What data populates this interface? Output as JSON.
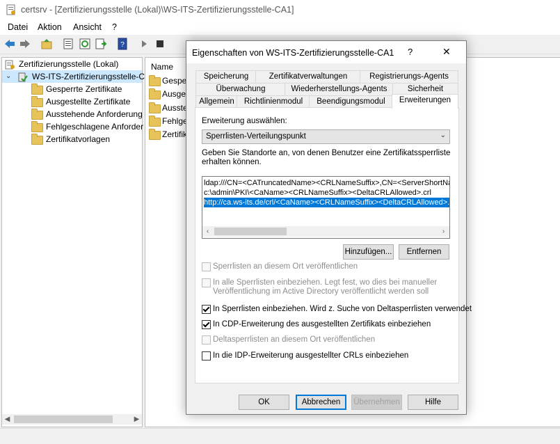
{
  "window": {
    "title": "certsrv - [Zertifizierungsstelle (Lokal)\\WS-ITS-Zertifizierungsstelle-CA1]"
  },
  "menu": [
    "Datei",
    "Aktion",
    "Ansicht",
    "?"
  ],
  "tree": {
    "root": "Zertifizierungsstelle (Lokal)",
    "ca": "WS-ITS-Zertifizierungsstelle-C",
    "folders": [
      "Gesperrte Zertifikate",
      "Ausgestellte Zertifikate",
      "Ausstehende Anforderung",
      "Fehlgeschlagene Anforder",
      "Zertifikatvorlagen"
    ]
  },
  "list": {
    "header": "Name",
    "items": [
      "Gesper",
      "Ausges",
      "Ausste",
      "Fehlge",
      "Zertifik"
    ]
  },
  "dialog": {
    "title": "Eigenschaften von WS-ITS-Zertifizierungsstelle-CA1",
    "help_label": "?",
    "close_label": "✕",
    "tabs_row1": [
      "Speicherung",
      "Zertifikatverwaltungen",
      "Registrierungs-Agents"
    ],
    "tabs_row2": [
      "Überwachung",
      "Wiederherstellungs-Agents",
      "Sicherheit"
    ],
    "tabs_row3": [
      "Allgemein",
      "Richtlinienmodul",
      "Beendigungsmodul",
      "Erweiterungen"
    ],
    "extension_label": "Erweiterung auswählen:",
    "extension_value": "Sperrlisten-Verteilungspunkt",
    "description": [
      "Geben Sie Standorte an, von denen Benutzer eine Zertifikatssperrliste",
      "erhalten können."
    ],
    "urls": [
      "ldap:///CN=<CATruncatedName><CRLNameSuffix>,CN=<ServerShortName>,CN=CDP,CN=Public Key Services",
      "c:\\admin\\PKI\\<CaName><CRLNameSuffix><DeltaCRLAllowed>.crl",
      "http://ca.ws-its.de/crl/<CaName><CRLNameSuffix><DeltaCRLAllowed>.crl"
    ],
    "add_label": "Hinzufügen...",
    "remove_label": "Entfernen",
    "options": [
      {
        "text": "Sperrlisten an diesem Ort veröffentlichen",
        "checked": false,
        "enabled": false
      },
      {
        "text": "In alle Sperrlisten einbeziehen. Legt fest, wo dies bei manueller",
        "text2": "Veröffentlichung im Active Directory veröffentlicht werden soll",
        "checked": false,
        "enabled": false
      },
      {
        "text": "In Sperrlisten einbeziehen. Wird z. Suche von Deltasperrlisten verwendet",
        "checked": true,
        "enabled": true
      },
      {
        "text": "In CDP-Erweiterung des ausgestellten Zertifikats einbeziehen",
        "checked": true,
        "enabled": true
      },
      {
        "text": "Deltasperrlisten an diesem Ort veröffentlichen",
        "checked": false,
        "enabled": false
      },
      {
        "text": "In die IDP-Erweiterung ausgestellter CRLs einbeziehen",
        "checked": false,
        "enabled": true
      }
    ],
    "buttons": {
      "ok": "OK",
      "cancel": "Abbrechen",
      "apply": "Übernehmen",
      "help": "Hilfe"
    }
  },
  "colors": {
    "accent": "#0078d7",
    "folder": "#e8c35a"
  }
}
